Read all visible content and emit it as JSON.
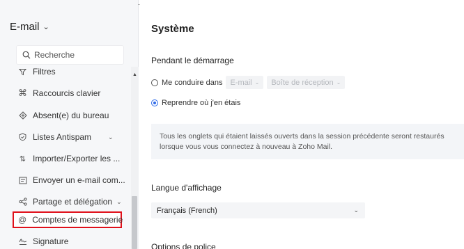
{
  "sidebar": {
    "title": "E-mail",
    "search_placeholder": "Recherche",
    "items": [
      {
        "label": "Filtres",
        "icon": "filter-icon"
      },
      {
        "label": "Raccourcis clavier",
        "icon": "command-key-icon"
      },
      {
        "label": "Absent(e) du bureau",
        "icon": "out-of-office-icon"
      },
      {
        "label": "Listes Antispam",
        "icon": "shield-icon",
        "expandable": true
      },
      {
        "label": "Importer/Exporter les ...",
        "icon": "import-export-icon"
      },
      {
        "label": "Envoyer un e-mail com...",
        "icon": "send-mail-icon"
      },
      {
        "label": "Partage et délégation",
        "icon": "share-icon",
        "expandable": true
      },
      {
        "label": "Comptes de messagerie",
        "icon": "at-sign-icon",
        "highlighted": true
      },
      {
        "label": "Signature",
        "icon": "signature-icon"
      }
    ]
  },
  "main": {
    "title": "Système",
    "startup": {
      "heading": "Pendant le démarrage",
      "option1_label": "Me conduire dans",
      "option1_selected": false,
      "option1_app": "E-mail",
      "option1_folder": "Boîte de réception",
      "option2_label": "Reprendre où j'en étais",
      "option2_selected": true,
      "info": "Tous les onglets qui étaient laissés ouverts dans la session précédente seront restaurés lorsque vous vous connectez à nouveau à Zoho Mail."
    },
    "language": {
      "heading": "Langue d'affichage",
      "selected": "Français (French)"
    },
    "next_heading": "Options de police"
  },
  "colors": {
    "highlight_border": "#e0101a",
    "radio_accent": "#2f6be8",
    "sidebar_bg": "#f6f7f9"
  }
}
